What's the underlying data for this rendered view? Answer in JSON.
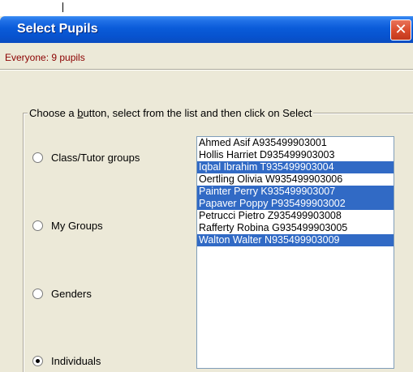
{
  "window": {
    "title": "Select Pupils",
    "close_glyph": "✕"
  },
  "status": "Everyone: 9 pupils",
  "group": {
    "legend_before": "Choose a ",
    "legend_accel": "b",
    "legend_after": "utton, select from the list and then click on Select"
  },
  "radios": [
    {
      "label": "Class/Tutor groups",
      "checked": false
    },
    {
      "label": "My Groups",
      "checked": false
    },
    {
      "label": "Genders",
      "checked": false
    },
    {
      "label": "Individuals",
      "checked": true
    }
  ],
  "pupils": [
    {
      "text": "Ahmed Asif A935499903001",
      "selected": false
    },
    {
      "text": "Hollis Harriet D935499903003",
      "selected": false
    },
    {
      "text": "Iqbal Ibrahim T935499903004",
      "selected": true
    },
    {
      "text": "Oertling Olivia W935499903006",
      "selected": false
    },
    {
      "text": "Painter Perry K935499903007",
      "selected": true
    },
    {
      "text": "Papaver Poppy P935499903002",
      "selected": true
    },
    {
      "text": "Petrucci Pietro Z935499903008",
      "selected": false
    },
    {
      "text": "Rafferty Robina G935499903005",
      "selected": false
    },
    {
      "text": "Walton Walter N935499903009",
      "selected": true
    }
  ],
  "colors": {
    "titlebar": "#0a5bd9",
    "selection": "#316ac5",
    "status_text": "#8b0000",
    "dialog_bg": "#ece9d8"
  }
}
